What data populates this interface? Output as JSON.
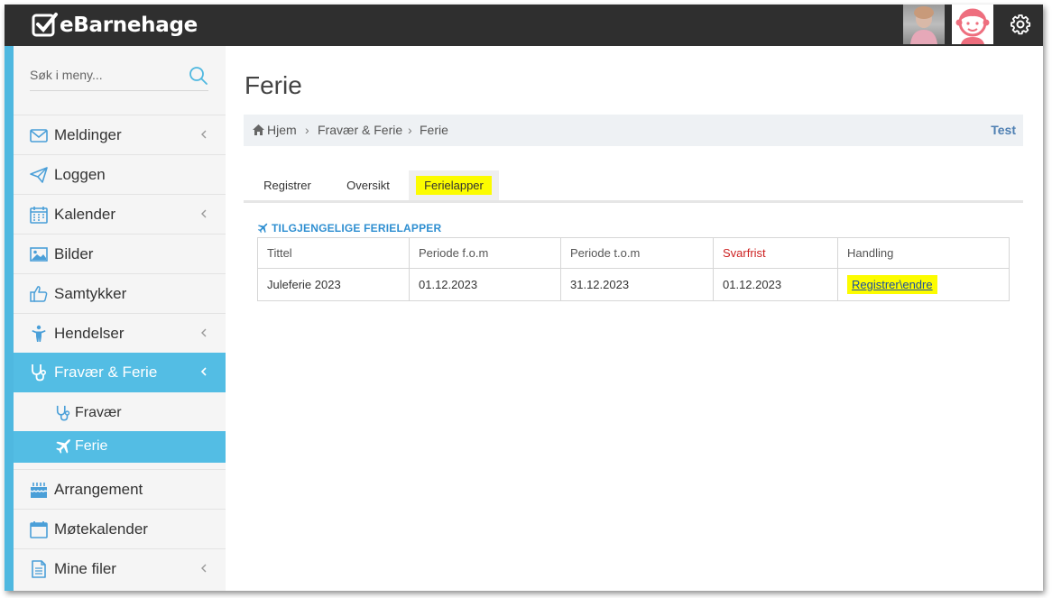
{
  "app": {
    "logo_text": "eBarnehage"
  },
  "colors": {
    "topbar": "#2f2f2f",
    "accent": "#53bde4",
    "highlight": "#fcfc00",
    "deadline": "#cc1f1f"
  },
  "sidebar": {
    "search_placeholder": "Søk i meny...",
    "items": [
      {
        "label": "Meldinger",
        "icon": "envelope-icon",
        "has_chevron": true
      },
      {
        "label": "Loggen",
        "icon": "paper-plane-icon",
        "has_chevron": false
      },
      {
        "label": "Kalender",
        "icon": "calendar-icon",
        "has_chevron": true
      },
      {
        "label": "Bilder",
        "icon": "image-icon",
        "has_chevron": false
      },
      {
        "label": "Samtykker",
        "icon": "thumbs-up-icon",
        "has_chevron": false
      },
      {
        "label": "Hendelser",
        "icon": "child-icon",
        "has_chevron": true
      },
      {
        "label": "Fravær & Ferie",
        "icon": "stethoscope-icon",
        "has_chevron": true,
        "active": true
      },
      {
        "label": "Arrangement",
        "icon": "birthday-cake-icon",
        "has_chevron": false
      },
      {
        "label": "Møtekalender",
        "icon": "calendar-blank-icon",
        "has_chevron": false
      },
      {
        "label": "Mine filer",
        "icon": "file-icon",
        "has_chevron": true
      }
    ],
    "subitems": [
      {
        "label": "Fravær",
        "icon": "stethoscope-icon"
      },
      {
        "label": "Ferie",
        "icon": "plane-icon",
        "active": true
      }
    ]
  },
  "main": {
    "title": "Ferie",
    "breadcrumb": {
      "home": "Hjem",
      "level1": "Fravær & Ferie",
      "level2": "Ferie",
      "right": "Test"
    },
    "tabs": [
      {
        "label": "Registrer"
      },
      {
        "label": "Oversikt"
      },
      {
        "label": "Ferielapper",
        "active": true
      }
    ],
    "section_title": "TILGJENGELIGE FERIELAPPER",
    "table": {
      "headers": [
        "Tittel",
        "Periode f.o.m",
        "Periode t.o.m",
        "Svarfrist",
        "Handling"
      ],
      "rows": [
        {
          "tittel": "Juleferie 2023",
          "fom": "01.12.2023",
          "tom": "31.12.2023",
          "svarfrist": "01.12.2023",
          "handling": "Registrer\\endre"
        }
      ]
    }
  }
}
